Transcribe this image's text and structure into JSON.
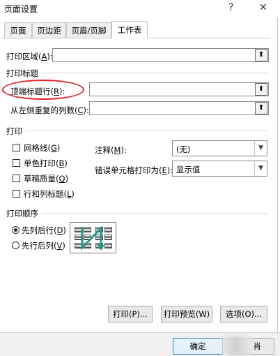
{
  "window": {
    "title": "页面设置",
    "help_symbol": "?",
    "close_symbol": "✕"
  },
  "tabs": [
    {
      "label": "页面",
      "active": false
    },
    {
      "label": "页边距",
      "active": false
    },
    {
      "label": "页眉/页脚",
      "active": false
    },
    {
      "label": "工作表",
      "active": true
    }
  ],
  "print_area": {
    "label": "打印区域(",
    "key": "A",
    "suffix": "):",
    "value": "",
    "collapse_icon": "⬆"
  },
  "print_titles": {
    "section_label": "打印标题",
    "rows_to_repeat": {
      "label": "顶端标题行(",
      "key": "R",
      "suffix": "):",
      "value": "",
      "highlight_color": "#e3262a"
    },
    "cols_to_repeat": {
      "label": "从左侧重复的列数(",
      "key": "C",
      "suffix": "):",
      "value": ""
    }
  },
  "print": {
    "section_label": "打印",
    "gridlines": {
      "label": "网格线(",
      "key": "G",
      "suffix": ")",
      "checked": false
    },
    "black_white": {
      "label": "单色打印(",
      "key": "B",
      "suffix": ")",
      "checked": false
    },
    "draft": {
      "label": "草稿质量(",
      "key": "Q",
      "suffix": ")",
      "checked": false
    },
    "headings": {
      "label": "行和列标题(",
      "key": "L",
      "suffix": ")",
      "checked": false
    },
    "comments": {
      "label": "注释(",
      "key": "M",
      "suffix": "):",
      "value": "(无)"
    },
    "cell_errors": {
      "label": "错误单元格打印为(",
      "key": "E",
      "suffix": "):",
      "value": "显示值"
    }
  },
  "page_order": {
    "section_label": "打印顺序",
    "down_then_over": {
      "label": "先列后行(",
      "key": "D",
      "suffix": ")",
      "selected": true
    },
    "over_then_down": {
      "label": "先行后列(",
      "key": "V",
      "suffix": ")",
      "selected": false
    },
    "arrow_color": "#1f9a8a"
  },
  "buttons": {
    "print": "打印(P)...",
    "print_preview": "打印预览(W)",
    "options": "选项(O)...",
    "ok": "确定",
    "cancel_partial": "肖"
  }
}
